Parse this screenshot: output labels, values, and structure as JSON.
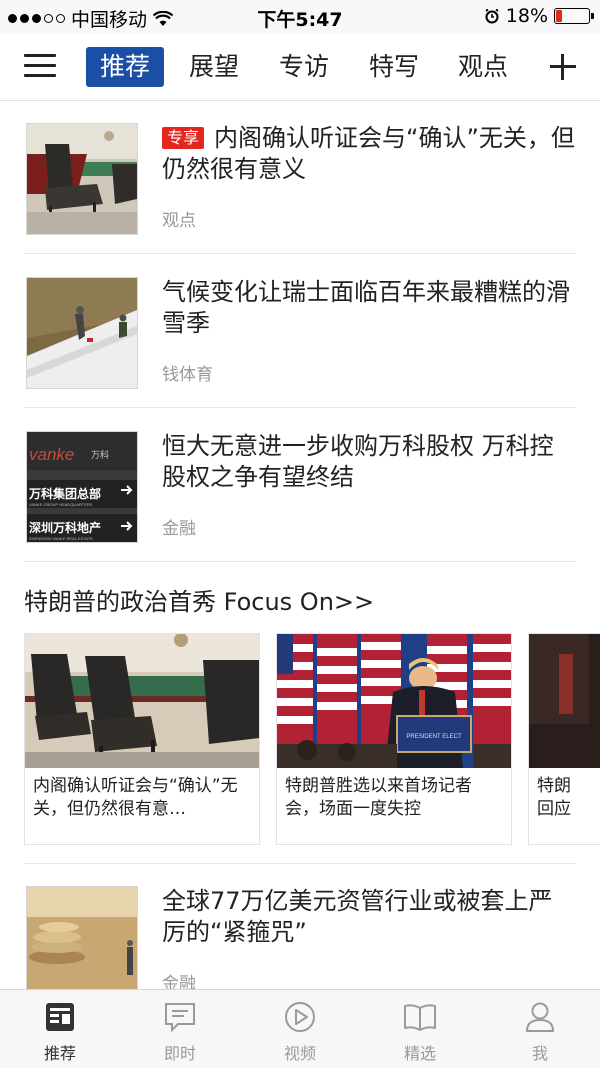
{
  "status": {
    "carrier": "中国移动",
    "time": "下午5:47",
    "battery": "18%",
    "battery_level": 0.18,
    "icons": [
      "signal-icon",
      "wifi-icon",
      "alarm-icon",
      "battery-icon"
    ]
  },
  "nav": {
    "tabs": [
      {
        "label": "推荐",
        "active": true
      },
      {
        "label": "展望",
        "active": false
      },
      {
        "label": "专访",
        "active": false
      },
      {
        "label": "特写",
        "active": false
      },
      {
        "label": "观点",
        "active": false
      }
    ],
    "icons": [
      "menu-icon",
      "plus-icon"
    ]
  },
  "articles": [
    {
      "badge": "专享",
      "title": "内阁确认听证会与“确认”无关，但仍然很有意义",
      "source": "观点"
    },
    {
      "title": "气候变化让瑞士面临百年来最糟糕的滑雪季",
      "source": "钱体育"
    },
    {
      "title": "恒大无意进一步收购万科股权 万科控股权之争有望终结",
      "source": "金融"
    },
    {
      "title": "全球77万亿美元资管行业或被套上严厉的“紧箍咒”",
      "source": "金融"
    }
  ],
  "section": {
    "title": "特朗普的政治首秀 Focus On>>",
    "cards": [
      {
        "text": "内阁确认听证会与“确认”无关，但仍然很有意…"
      },
      {
        "text": "特朗普胜选以来首场记者会，场面一度失控"
      },
      {
        "text": "特朗回应"
      }
    ]
  },
  "thumb_text": {
    "vanke_brand": "vanke",
    "vanke_cn": "万科",
    "vanke_hq": "万科集团总部",
    "vanke_hq_en": "VANKE GROUP HEADQUARTERS",
    "vanke_sz": "深圳万科地产",
    "vanke_sz_en": "SHENZHEN VANKE REAL ESTATE",
    "podium_text": "PRESIDENT ELECT"
  },
  "bottom_nav": [
    {
      "label": "推荐",
      "icon": "news-icon",
      "active": true
    },
    {
      "label": "即时",
      "icon": "chat-icon",
      "active": false
    },
    {
      "label": "视频",
      "icon": "play-icon",
      "active": false
    },
    {
      "label": "精选",
      "icon": "book-icon",
      "active": false
    },
    {
      "label": "我",
      "icon": "user-icon",
      "active": false
    }
  ],
  "colors": {
    "accent": "#1b4fa6",
    "badge": "#e3261e",
    "text": "#222222",
    "muted": "#999999"
  }
}
